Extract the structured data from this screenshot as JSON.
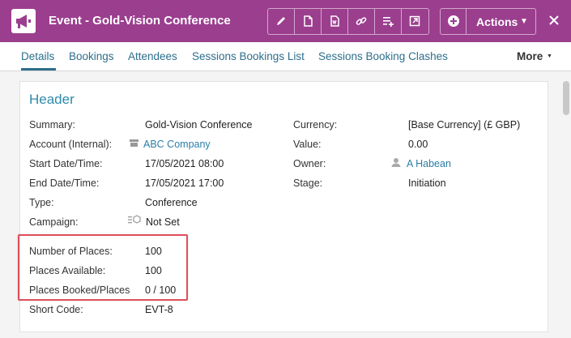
{
  "window": {
    "title": "Event - Gold-Vision Conference",
    "app_icon": "megaphone-icon",
    "accent_color": "#9b3e8e"
  },
  "toolbar": {
    "buttons": [
      {
        "icon": "pencil-icon"
      },
      {
        "icon": "document-icon"
      },
      {
        "icon": "word-document-icon"
      },
      {
        "icon": "link-icon"
      },
      {
        "icon": "add-to-list-icon"
      },
      {
        "icon": "open-external-icon"
      }
    ],
    "add_icon": "plus-circle-icon",
    "actions_label": "Actions",
    "close_icon": "close-icon"
  },
  "tabs": {
    "items": [
      "Details",
      "Bookings",
      "Attendees",
      "Sessions Bookings List",
      "Sessions Booking Clashes"
    ],
    "active": "Details",
    "more_label": "More"
  },
  "header": {
    "title": "Header",
    "left_fields": [
      {
        "label": "Summary:",
        "value": "Gold-Vision Conference"
      },
      {
        "label": "Account (Internal):",
        "value": "ABC Company"
      },
      {
        "label": "Start Date/Time:",
        "value": "17/05/2021 08:00"
      },
      {
        "label": "End Date/Time:",
        "value": "17/05/2021 17:00"
      },
      {
        "label": "Type:",
        "value": "Conference"
      },
      {
        "label": "Campaign:",
        "value": "Not Set"
      },
      {
        "label": "Number of Places:",
        "value": "100"
      },
      {
        "label": "Places Available:",
        "value": "100"
      },
      {
        "label": "Places Booked/Places",
        "value": "0 / 100"
      },
      {
        "label": "Short Code:",
        "value": "EVT-8"
      }
    ],
    "right_fields": [
      {
        "label": "Currency:",
        "value": "[Base Currency] (£ GBP)"
      },
      {
        "label": "Value:",
        "value": "0.00"
      },
      {
        "label": "Owner:",
        "value": "A Habean"
      },
      {
        "label": "Stage:",
        "value": "Initiation"
      }
    ]
  }
}
